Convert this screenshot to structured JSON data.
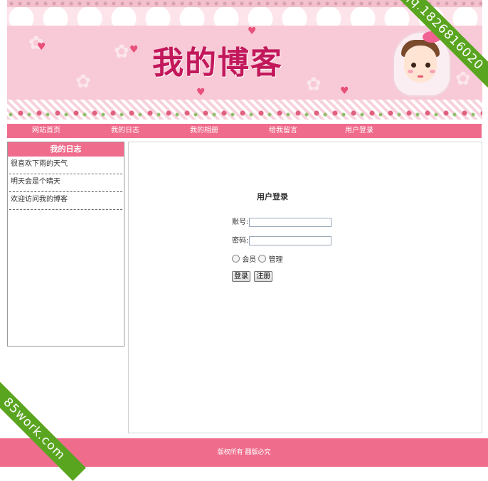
{
  "banner": {
    "title": "我的博客"
  },
  "nav": {
    "items": [
      {
        "label": "网站首页"
      },
      {
        "label": "我的日志"
      },
      {
        "label": "我的相册"
      },
      {
        "label": "给我留言"
      },
      {
        "label": "用户登录"
      }
    ]
  },
  "sidebar": {
    "title": "我的日志",
    "items": [
      {
        "label": "很喜欢下雨的天气"
      },
      {
        "label": "明天会是个晴天"
      },
      {
        "label": "欢迎访问我的博客"
      }
    ]
  },
  "login": {
    "title": "用户登录",
    "account_label": "账号:",
    "account_value": "",
    "password_label": "密码:",
    "password_value": "",
    "role_member": "会员",
    "role_admin": "管理",
    "login_button": "登录",
    "register_button": "注册"
  },
  "footer": {
    "text": "版权所有 翻版必究"
  },
  "watermarks": {
    "top_right": "qq.1826816020",
    "bottom_left": "85work.com"
  },
  "colors": {
    "accent": "#f06c8c",
    "banner_bg": "#f8c9d6",
    "title": "#c2185b",
    "ribbon": "#5aa520"
  }
}
